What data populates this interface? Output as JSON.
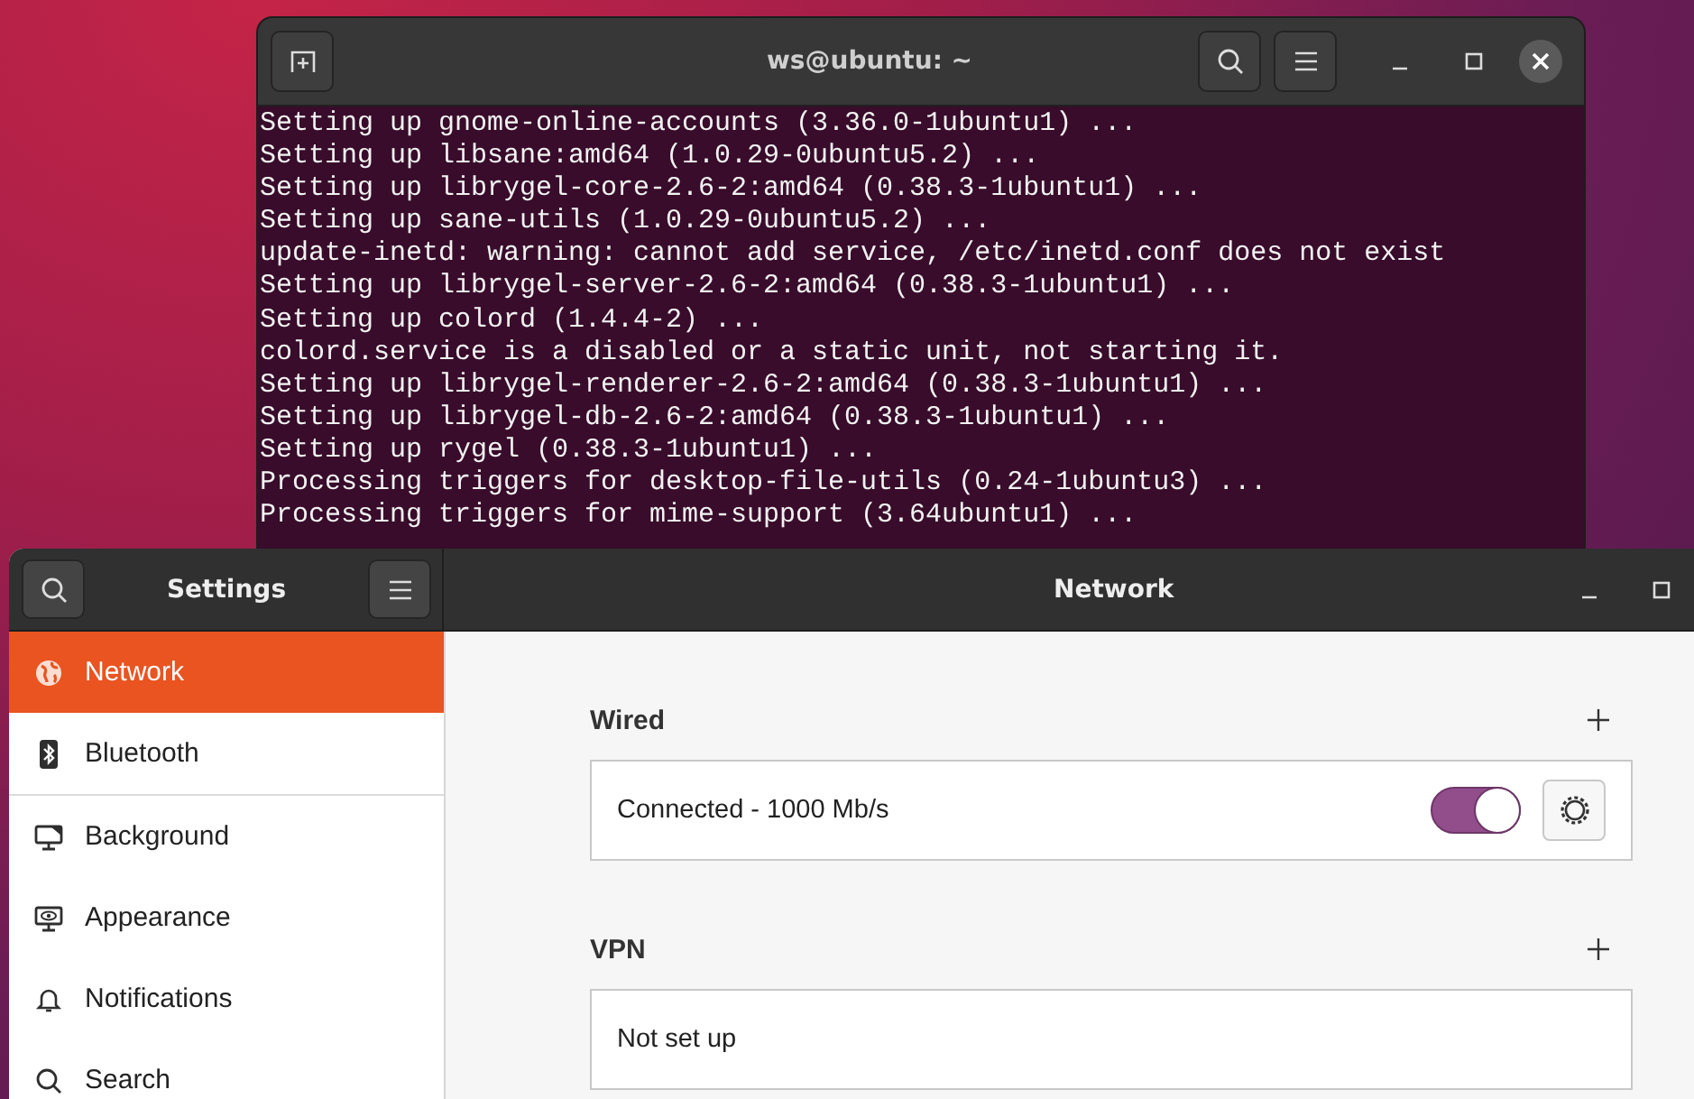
{
  "terminal": {
    "title": "ws@ubuntu: ~",
    "lines": [
      "Setting up gnome-online-accounts (3.36.0-1ubuntu1) ...",
      "Setting up libsane:amd64 (1.0.29-0ubuntu5.2) ...",
      "Setting up librygel-core-2.6-2:amd64 (0.38.3-1ubuntu1) ...",
      "Setting up sane-utils (1.0.29-0ubuntu5.2) ...",
      "update-inetd: warning: cannot add service, /etc/inetd.conf does not exist",
      "Setting up librygel-server-2.6-2:amd64 (0.38.3-1ubuntu1) ...",
      "Setting up colord (1.4.4-2) ...",
      "colord.service is a disabled or a static unit, not starting it.",
      "Setting up librygel-renderer-2.6-2:amd64 (0.38.3-1ubuntu1) ...",
      "Setting up librygel-db-2.6-2:amd64 (0.38.3-1ubuntu1) ...",
      "Setting up rygel (0.38.3-1ubuntu1) ...",
      "Processing triggers for desktop-file-utils (0.24-1ubuntu3) ...",
      "Processing triggers for mime-support (3.64ubuntu1) ..."
    ]
  },
  "settings": {
    "title": "Settings",
    "sidebar": {
      "groups": [
        [
          {
            "label": "Network",
            "kind": "network",
            "selected": true
          },
          {
            "label": "Bluetooth",
            "kind": "bluetooth",
            "selected": false
          }
        ],
        [
          {
            "label": "Background",
            "kind": "background",
            "selected": false
          },
          {
            "label": "Appearance",
            "kind": "appearance",
            "selected": false
          },
          {
            "label": "Notifications",
            "kind": "notifications",
            "selected": false
          },
          {
            "label": "Search",
            "kind": "search",
            "selected": false
          }
        ]
      ]
    },
    "panel": {
      "title": "Network",
      "sections": [
        {
          "heading": "Wired",
          "rows": [
            {
              "kind": "connection",
              "label": "Connected - 1000 Mb/s",
              "on": true
            }
          ]
        },
        {
          "heading": "VPN",
          "rows": [
            {
              "kind": "empty",
              "label": "Not set up"
            }
          ]
        }
      ]
    }
  }
}
